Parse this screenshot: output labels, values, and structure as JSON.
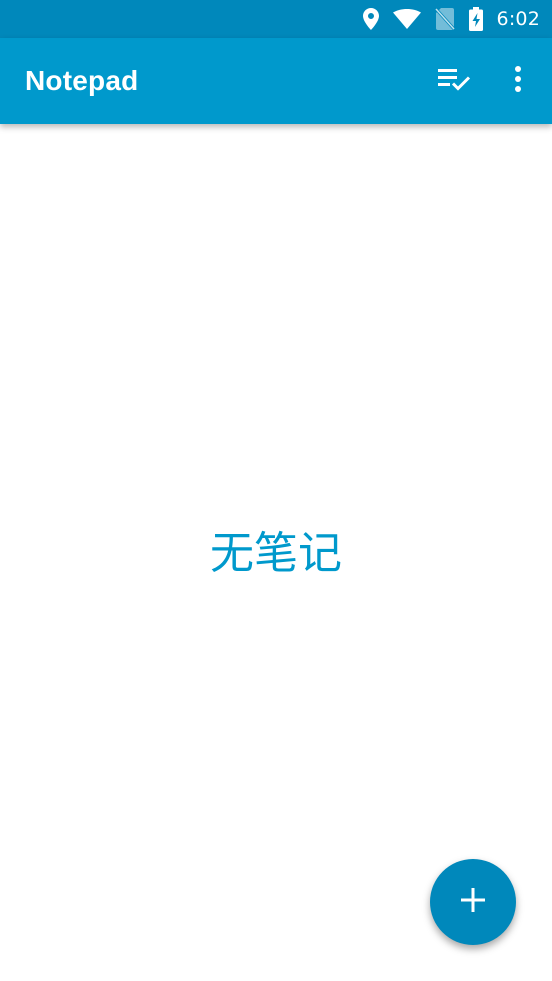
{
  "status_bar": {
    "time": "6:02",
    "icons": [
      "location-icon",
      "wifi-icon",
      "no-sim-icon",
      "battery-charging-icon"
    ]
  },
  "app_bar": {
    "title": "Notepad",
    "actions": [
      "checklist-icon",
      "more-vert-icon"
    ]
  },
  "main": {
    "empty_message": "无笔记"
  },
  "fab": {
    "icon": "add-icon"
  },
  "colors": {
    "status_bar": "#0088bb",
    "app_bar": "#0099cc",
    "accent": "#0099cc",
    "fab": "#0088bb"
  }
}
